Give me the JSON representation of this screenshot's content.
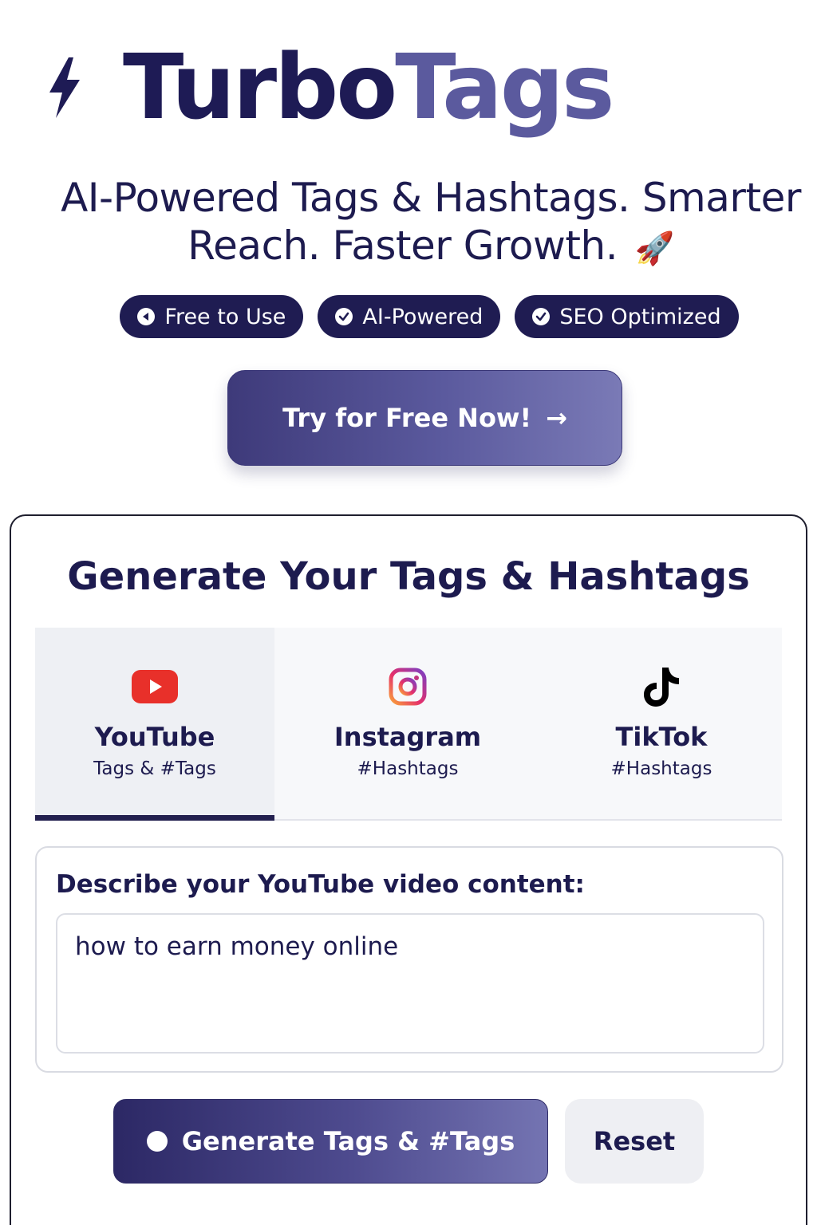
{
  "brand": {
    "name_part1": "Turbo",
    "name_part2": "Tags"
  },
  "hero": {
    "tagline_line1": "AI-Powered Tags & Hashtags. Smarter",
    "tagline_line2": "Reach. Faster Growth.",
    "emoji": "🚀"
  },
  "badges": [
    {
      "label": "Free to Use",
      "icon": "play-left-icon"
    },
    {
      "label": "AI-Powered",
      "icon": "check-circle-icon"
    },
    {
      "label": "SEO Optimized",
      "icon": "check-circle-icon"
    }
  ],
  "cta": {
    "label": "Try for Free Now!",
    "arrow": "→"
  },
  "generator": {
    "title": "Generate Your Tags & Hashtags",
    "tabs": [
      {
        "label": "YouTube",
        "sub": "Tags & #Tags",
        "icon": "youtube-icon",
        "active": true
      },
      {
        "label": "Instagram",
        "sub": "#Hashtags",
        "icon": "instagram-icon",
        "active": false
      },
      {
        "label": "TikTok",
        "sub": "#Hashtags",
        "icon": "tiktok-icon",
        "active": false
      }
    ],
    "input_label": "Describe your YouTube video content:",
    "input_value": "how to earn money online",
    "generate_label": "Generate Tags & #Tags",
    "reset_label": "Reset"
  },
  "colors": {
    "navy": "#1e1b55",
    "accent": "#5b5a9e",
    "youtube_red": "#e8302a"
  }
}
